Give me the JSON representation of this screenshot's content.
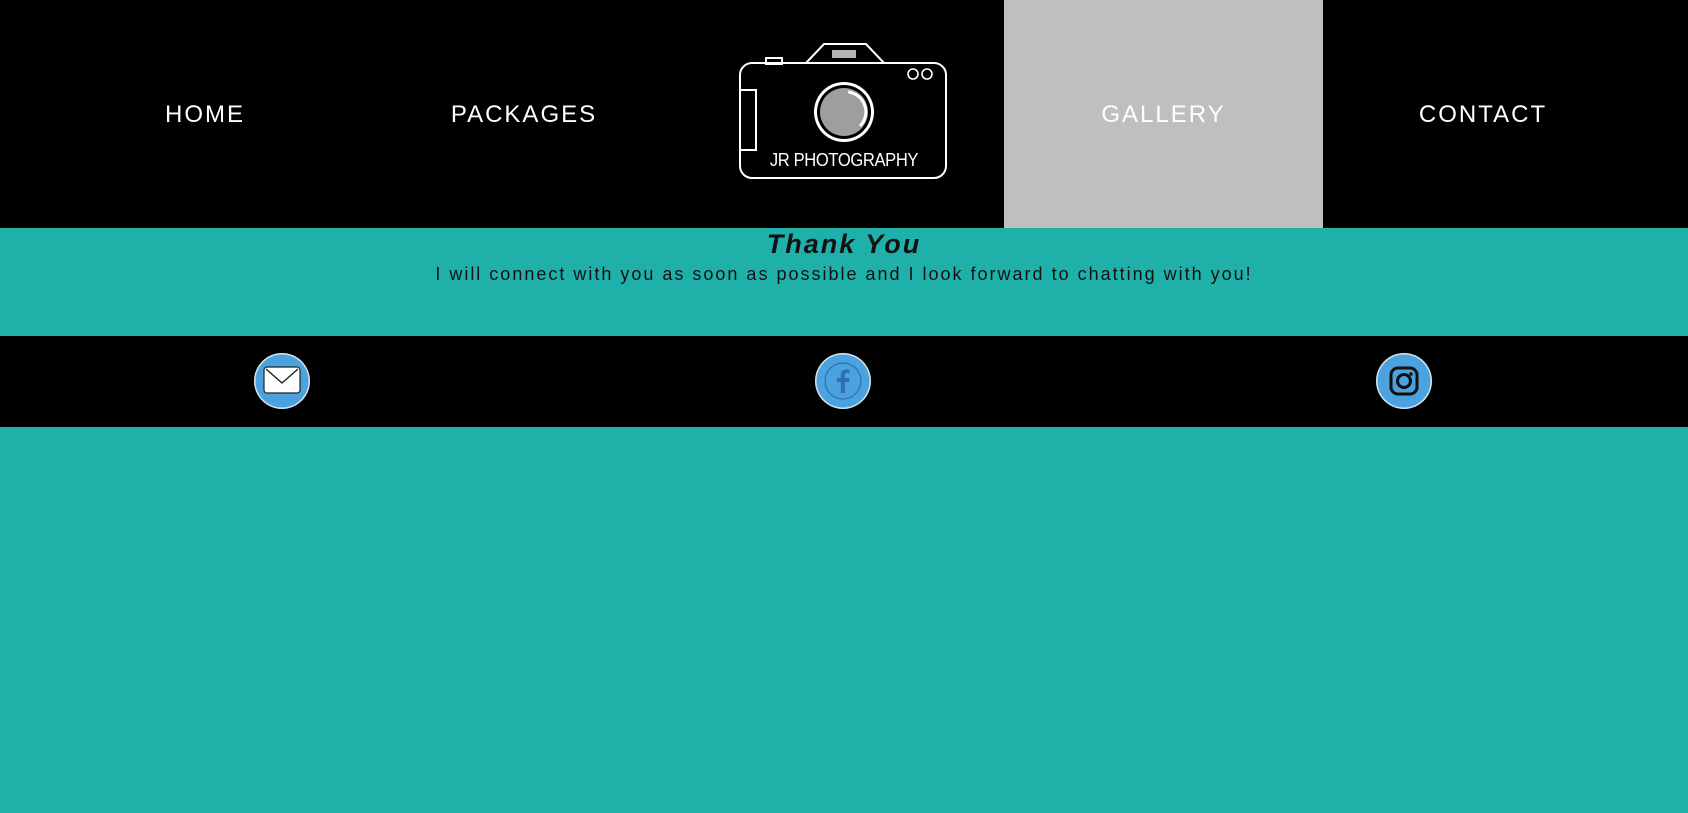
{
  "nav": {
    "items": [
      {
        "label": "HOME"
      },
      {
        "label": "PACKAGES"
      },
      {
        "label": "GALLERY",
        "active": true
      },
      {
        "label": "CONTACT"
      }
    ],
    "logo_text": "JR PHOTOGRAPHY"
  },
  "main": {
    "title": "Thank You",
    "message": "I will connect with you as soon as possible and I look forward to chatting with you!"
  },
  "social": {
    "items": [
      {
        "icon": "email-icon"
      },
      {
        "icon": "facebook-icon"
      },
      {
        "icon": "instagram-icon"
      }
    ]
  },
  "colors": {
    "background": "#20b0aa",
    "nav": "#000000",
    "active_nav": "#bfbfbf",
    "social_button": "#4aa3df"
  }
}
